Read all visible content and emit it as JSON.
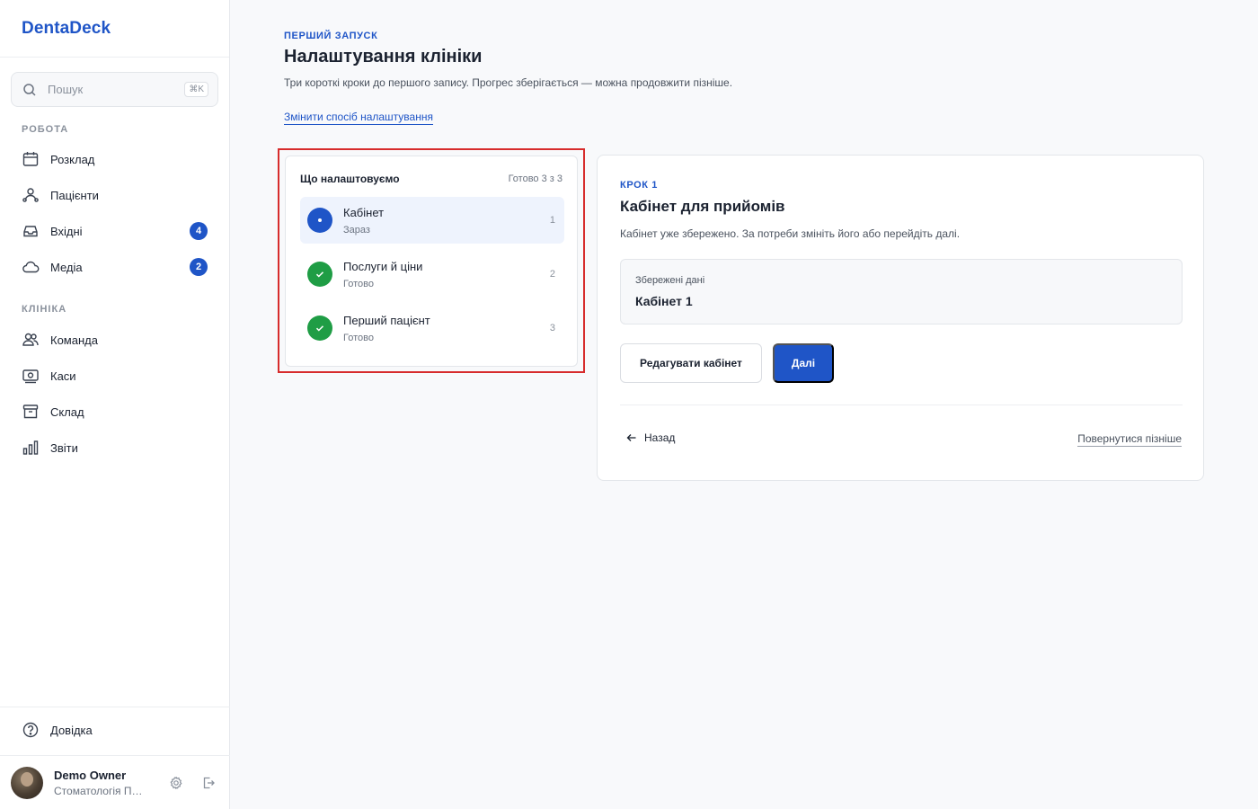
{
  "app": {
    "brand": "DentaDeck"
  },
  "sidebar": {
    "search": {
      "placeholder": "Пошук",
      "shortcut": "⌘K"
    },
    "sections": [
      {
        "label": "РОБОТА"
      },
      {
        "label": "КЛІНІКА"
      }
    ],
    "work_items": [
      {
        "label": "Розклад",
        "icon": "calendar-icon"
      },
      {
        "label": "Пацієнти",
        "icon": "patients-icon"
      },
      {
        "label": "Вхідні",
        "icon": "inbox-icon",
        "badge": "4"
      },
      {
        "label": "Медіа",
        "icon": "cloud-icon",
        "badge": "2"
      }
    ],
    "clinic_items": [
      {
        "label": "Команда",
        "icon": "team-icon"
      },
      {
        "label": "Каси",
        "icon": "cash-register-icon"
      },
      {
        "label": "Склад",
        "icon": "warehouse-icon"
      },
      {
        "label": "Звіти",
        "icon": "reports-icon"
      }
    ],
    "help": {
      "label": "Довідка",
      "icon": "help-icon"
    },
    "user": {
      "name": "Demo Owner",
      "org": "Стоматологія Перша"
    }
  },
  "main": {
    "eyebrow": "ПЕРШИЙ ЗАПУСК",
    "title": "Налаштування клініки",
    "subtitle": "Три короткі кроки до першого запису. Прогрес зберігається — можна продовжити пізніше.",
    "change_link": "Змінити спосіб налаштування",
    "steps": {
      "title": "Що налаштовуємо",
      "count": "Готово 3 з 3",
      "items": [
        {
          "name": "Кабінет",
          "status": "Зараз",
          "num": "1",
          "state": "current"
        },
        {
          "name": "Послуги й ціни",
          "status": "Готово",
          "num": "2",
          "state": "done"
        },
        {
          "name": "Перший пацієнт",
          "status": "Готово",
          "num": "3",
          "state": "done"
        }
      ]
    },
    "card": {
      "kicker": "КРОК 1",
      "title": "Кабінет для прийомів",
      "description": "Кабінет уже збережено. За потреби змініть його або перейдіть далі.",
      "saved_label": "Збережені дані",
      "saved_value": "Кабінет 1",
      "edit_button": "Редагувати кабінет",
      "next_button": "Далі",
      "back_link": "Назад",
      "later_link": "Повернутися пізніше"
    }
  },
  "colors": {
    "accent": "#1f55c7",
    "success": "#1f9d45",
    "highlight": "#d72c2c"
  }
}
